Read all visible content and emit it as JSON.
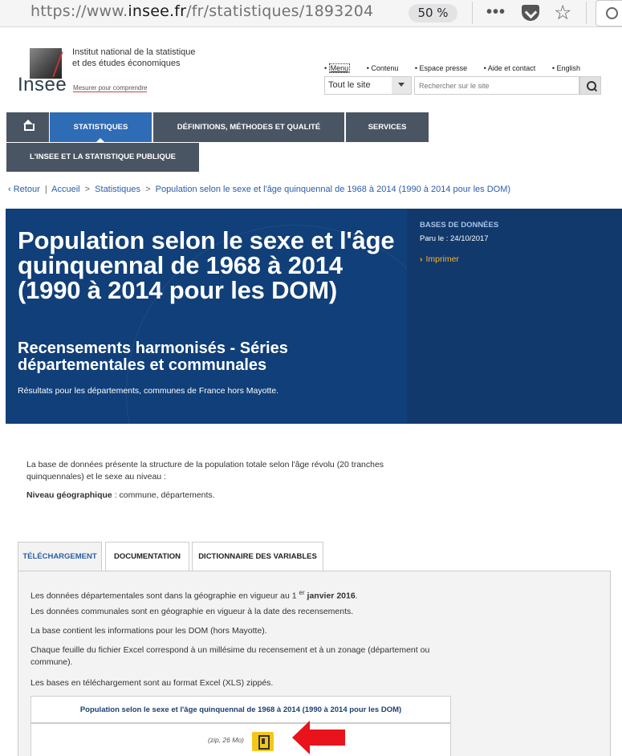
{
  "browser": {
    "url_prefix": "https://www.",
    "url_domain": "insee.fr",
    "url_path": "/fr/statistiques/1893204",
    "zoom": "50 %"
  },
  "header": {
    "logo_text": "Insee",
    "institute_line1": "Institut national de la statistique",
    "institute_line2": "et des études économiques",
    "tagline": "Mesurer pour comprendre",
    "top_links": [
      "Menu",
      "Contenu",
      "Espace presse",
      "Aide et contact",
      "English"
    ],
    "site_select": "Tout le site",
    "search_placeholder": "Rechercher sur le site"
  },
  "nav": {
    "statistiques": "STATISTIQUES",
    "definitions": "DÉFINITIONS, MÉTHODES ET QUALITÉ",
    "services": "SERVICES",
    "insee_stat": "L'INSEE ET LA STATISTIQUE PUBLIQUE"
  },
  "breadcrumb": {
    "back": "Retour",
    "home": "Accueil",
    "stats": "Statistiques",
    "current": "Population selon le sexe et l'âge quinquennal de 1968 à 2014 (1990 à 2014 pour les DOM)"
  },
  "hero": {
    "title": "Population selon le sexe et l'âge quinquennal de 1968 à 2014 (1990 à 2014 pour les DOM)",
    "subtitle": "Recensements harmonisés - Séries départementales et communales",
    "description": "Résultats pour les départements, communes de France hors Mayotte.",
    "side_label": "BASES DE DONNÉES",
    "side_date": "Paru le : 24/10/2017",
    "print": "Imprimer"
  },
  "intro": {
    "text": "La base de données présente la structure de la population totale selon l'âge révolu (20 tranches quinquennales) et le sexe au niveau :",
    "geo_label": "Niveau géographique",
    "geo_value": " : commune, départements."
  },
  "tabs": [
    "TÉLÉCHARGEMENT",
    "DOCUMENTATION",
    "DICTIONNAIRE DES VARIABLES"
  ],
  "panel": {
    "line1_a": "Les données départementales sont dans la géographie en vigueur au 1 ",
    "line1_sup": "er",
    "line1_b": " janvier 2016",
    "line1_c": ".",
    "line2": "Les données communales sont en géographie en vigueur à la date des recensements.",
    "line3": "La base contient les informations pour les DOM (hors Mayotte).",
    "line4": "Chaque feuille du fichier Excel correspond à un millésime du recensement et à un zonage (département ou commune).",
    "line5": "Les bases en téléchargement sont au format Excel (XLS) zippés.",
    "table_title": "Population selon le sexe et l'âge quinquennal de 1968 à 2014 (1990 à 2014 pour les DOM)",
    "file_size": "(zip, 26 Mo)"
  },
  "colors": {
    "hero_bg": "#103f79",
    "nav_bg": "#4a5563",
    "nav_active": "#2e6cb5",
    "link": "#2a5da8",
    "print_accent": "#f5b42e",
    "arrow": "#e8131b"
  }
}
